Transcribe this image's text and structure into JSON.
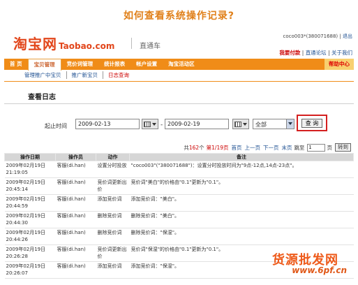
{
  "banner": {
    "title": "如何查看系统操作记录?"
  },
  "brand": {
    "logo_cn": "淘宝网",
    "logo_en": "Taobao.com",
    "product": "直通车"
  },
  "user_bar": {
    "account": "coco003*(380071688)",
    "separator": "|",
    "logout": "退出"
  },
  "top_links": {
    "want_pay": "我要付款",
    "forum": "直通论坛",
    "about": "关于我们"
  },
  "nav": {
    "tabs": [
      "首 页",
      "宝贝管理",
      "竞价词管理",
      "统计报表",
      "帐户设置",
      "淘宝活动区"
    ],
    "active_index": 1,
    "help": "帮助中心"
  },
  "subnav": {
    "items": [
      "管理推广中宝贝",
      "推广新宝贝",
      "日志查询"
    ],
    "selected_index": 2
  },
  "page": {
    "title": "查看日志"
  },
  "filter": {
    "label": "起止时间",
    "start_date": "2009-02-13",
    "dash": "-",
    "end_date": "2009-02-19",
    "type_value": "全部",
    "query_button": "查 询"
  },
  "pager": {
    "text_total_prefix": "共",
    "total": "162",
    "text_total_suffix": "个",
    "page_info": "第1/19页",
    "first": "首页",
    "prev": "上一页",
    "next": "下一页",
    "last": "末页",
    "goto_label": "跳至",
    "goto_value": "1",
    "page_suffix": "页",
    "go_button": "转到"
  },
  "table": {
    "headers": [
      "操作日期",
      "操作员",
      "动作",
      "备注"
    ],
    "rows": [
      {
        "date": "2009年02月19日 21:19:05",
        "operator": "客服(di.han)",
        "action": "设置分时投放",
        "note": "\"coco003\"(\"380071688\")：设置分时投放时间为\"9点-12点,14点-23点\"。"
      },
      {
        "date": "2009年02月19日 20:45:14",
        "operator": "客服(di.han)",
        "action": "竞价词更新出价",
        "note": "竞价词\"美白\"的价格由\"0.1\"更新为\"0.1\"。"
      },
      {
        "date": "2009年02月19日 20:44:59",
        "operator": "客服(di.han)",
        "action": "添加竞价词",
        "note": "添加竞价词：\"美白\"。"
      },
      {
        "date": "2009年02月19日 20:44:30",
        "operator": "客服(di.han)",
        "action": "删除竞价词",
        "note": "删除竞价词：\"美白\"。"
      },
      {
        "date": "2009年02月19日 20:44:26",
        "operator": "客服(di.han)",
        "action": "删除竞价词",
        "note": "删除竞价词：\"保湿\"。"
      },
      {
        "date": "2009年02月19日 20:26:28",
        "operator": "客服(di.han)",
        "action": "竞价词更新出价",
        "note": "竞价词\"保湿\"的价格由\"0.1\"更新为\"0.1\"。"
      },
      {
        "date": "2009年02月19日 20:26:07",
        "operator": "客服(di.han)",
        "action": "添加竞价词",
        "note": "添加竞价词：\"保湿\"。"
      }
    ]
  },
  "watermark": {
    "line1": "货源批发网",
    "line2": "www.6pf.cn"
  }
}
